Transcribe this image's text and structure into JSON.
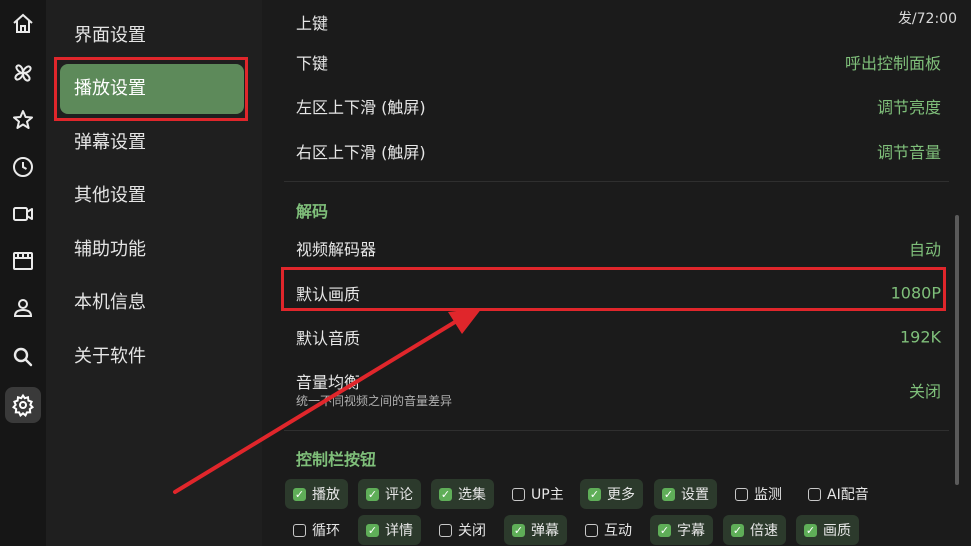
{
  "rail": [
    {
      "name": "home-icon",
      "active": false
    },
    {
      "name": "pinwheel-icon",
      "active": false
    },
    {
      "name": "star-icon",
      "active": false
    },
    {
      "name": "clock-icon",
      "active": false
    },
    {
      "name": "video-camera-icon",
      "active": false
    },
    {
      "name": "film-icon",
      "active": false
    },
    {
      "name": "user-icon",
      "active": false
    },
    {
      "name": "search-icon",
      "active": false
    },
    {
      "name": "gear-icon",
      "active": true
    }
  ],
  "categories": [
    "界面设置",
    "播放设置",
    "弹幕设置",
    "其他设置",
    "辅助功能",
    "本机信息",
    "关于软件"
  ],
  "active_category": 1,
  "top_right": "发/72:00",
  "rows_top": [
    {
      "label": "上键",
      "value": ""
    },
    {
      "label": "下键",
      "value": "呼出控制面板"
    },
    {
      "label": "左区上下滑 (触屏)",
      "value": "调节亮度"
    },
    {
      "label": "右区上下滑 (触屏)",
      "value": "调节音量"
    }
  ],
  "decode": {
    "title": "解码",
    "rows": [
      {
        "label": "视频解码器",
        "value": "自动"
      },
      {
        "label": "默认画质",
        "value": "1080P"
      },
      {
        "label": "默认音质",
        "value": "192K"
      },
      {
        "label": "音量均衡",
        "value": "关闭",
        "sub": "统一不同视频之间的音量差异"
      }
    ]
  },
  "controls": {
    "title": "控制栏按钮",
    "row1": [
      {
        "label": "播放",
        "checked": true
      },
      {
        "label": "评论",
        "checked": true
      },
      {
        "label": "选集",
        "checked": true
      },
      {
        "label": "UP主",
        "checked": false
      },
      {
        "label": "更多",
        "checked": true
      },
      {
        "label": "设置",
        "checked": true
      },
      {
        "label": "监测",
        "checked": false
      },
      {
        "label": "AI配音",
        "checked": false
      }
    ],
    "row2": [
      {
        "label": "循环",
        "checked": false
      },
      {
        "label": "详情",
        "checked": true
      },
      {
        "label": "关闭",
        "checked": false
      },
      {
        "label": "弹幕",
        "checked": true
      },
      {
        "label": "互动",
        "checked": false
      },
      {
        "label": "字幕",
        "checked": true
      },
      {
        "label": "倍速",
        "checked": true
      },
      {
        "label": "画质",
        "checked": true
      }
    ]
  },
  "colors": {
    "accent": "#7fbf7a",
    "active_bg": "#5d8a5a",
    "annotation": "#e0262b"
  }
}
